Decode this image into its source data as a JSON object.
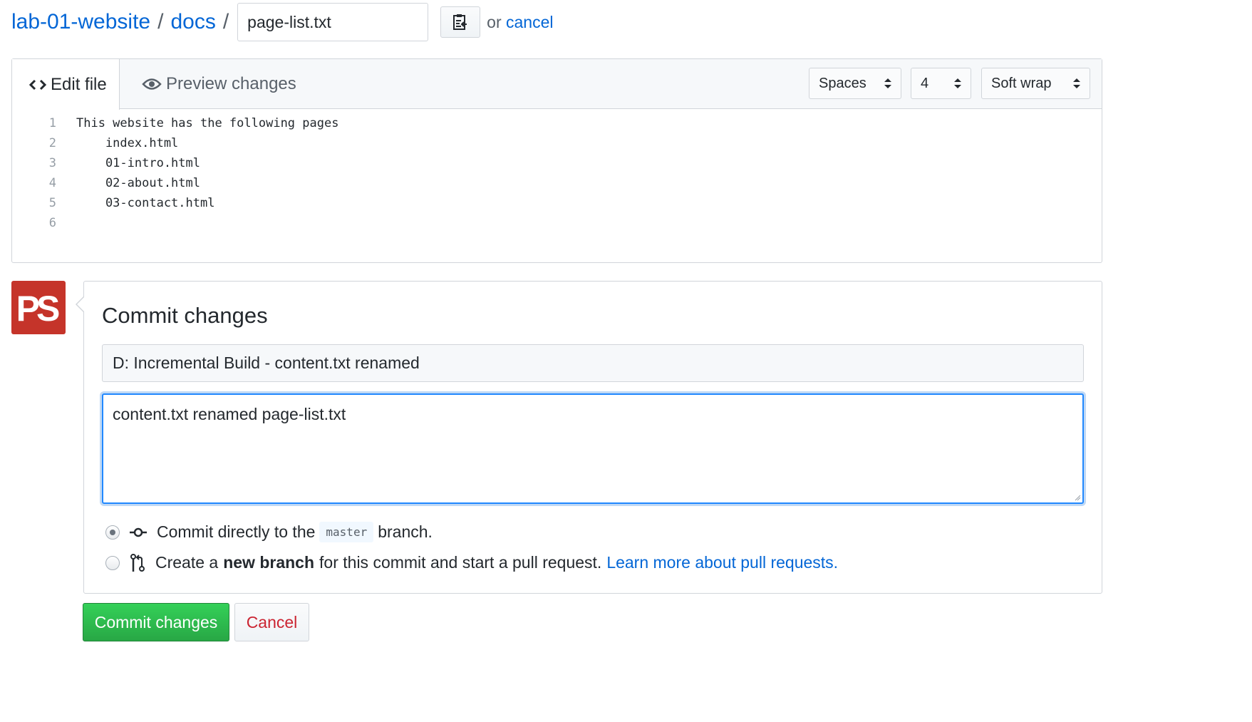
{
  "breadcrumb": {
    "repo": "lab-01-website",
    "separator": "/",
    "folder": "docs",
    "filename_value": "page-list.txt",
    "or_text": "or",
    "cancel_label": "cancel"
  },
  "editor": {
    "tab_edit_label": "Edit file",
    "tab_preview_label": "Preview changes",
    "indent_mode": "Spaces",
    "indent_size": "4",
    "wrap_mode": "Soft wrap",
    "lines": [
      {
        "num": "1",
        "text": "This website has the following pages"
      },
      {
        "num": "2",
        "text": "    index.html"
      },
      {
        "num": "3",
        "text": "    01-intro.html"
      },
      {
        "num": "4",
        "text": "    02-about.html"
      },
      {
        "num": "5",
        "text": "    03-contact.html"
      },
      {
        "num": "6",
        "text": ""
      }
    ]
  },
  "avatar": {
    "letters": "PS",
    "color": "#c5342a"
  },
  "commit": {
    "title": "Commit changes",
    "summary_value": "D: Incremental Build - content.txt renamed",
    "description_value": "content.txt renamed page-list.txt",
    "option_direct": {
      "prefix": "Commit directly to the",
      "branch": "master",
      "suffix": "branch."
    },
    "option_new_branch": {
      "prefix": "Create a",
      "bold": "new branch",
      "suffix": "for this commit and start a pull request.",
      "link": "Learn more about pull requests."
    }
  },
  "buttons": {
    "commit_label": "Commit changes",
    "cancel_label": "Cancel"
  },
  "colors": {
    "link": "#0366d6",
    "commit_green": "#28a745",
    "cancel_red": "#cb2431",
    "focus_blue": "#2188ff"
  }
}
